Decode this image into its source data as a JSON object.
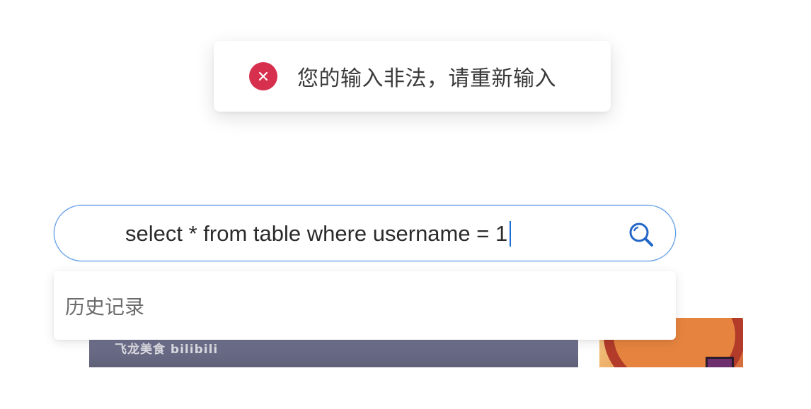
{
  "toast": {
    "icon": "error-circle-icon",
    "icon_color": "#d6304e",
    "message": "您的输入非法，请重新输入"
  },
  "search": {
    "value": "select * from table where username = 1",
    "border_color": "#4a90e2",
    "button_icon": "search-icon"
  },
  "dropdown": {
    "history_label": "历史记录"
  },
  "thumbnails": {
    "left_watermark": "飞龙美食 bilibili"
  }
}
